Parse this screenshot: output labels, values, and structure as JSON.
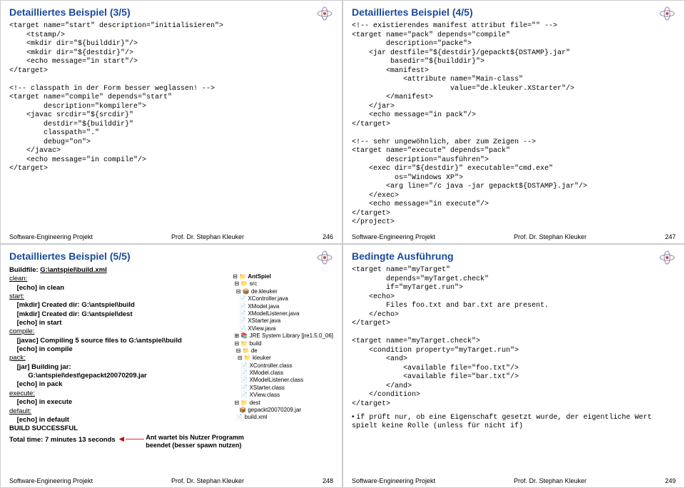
{
  "slides": {
    "s1": {
      "title": "Detailliertes Beispiel (3/5)",
      "code": "<target name=\"start\" description=\"initialisieren\">\n    <tstamp/>\n    <mkdir dir=\"${builddir}\"/>\n    <mkdir dir=\"${destdir}\"/>\n    <echo message=\"in start\"/>\n</target>\n\n<!-- classpath in der Form besser weglassen! -->\n<target name=\"compile\" depends=\"start\"\n        description=\"kompilere\">\n    <javac srcdir=\"${srcdir}\"\n        destdir=\"${builddir}\"\n        classpath=\".\"\n        debug=\"on\">\n    </javac>\n    <echo message=\"in compile\"/>\n</target>",
      "page": "246"
    },
    "s2": {
      "title": "Detailliertes Beispiel (4/5)",
      "code": "<!-- existierendes manifest attribut file=\"\" -->\n<target name=\"pack\" depends=\"compile\"\n        description=\"packe\">\n    <jar destfile=\"${destdir}/gepackt${DSTAMP}.jar\"\n         basedir=\"${builddir}\">\n        <manifest>\n            <attribute name=\"Main-class\"\n                       value=\"de.kleuker.XStarter\"/>\n        </manifest>\n    </jar>\n    <echo message=\"in pack\"/>\n</target>\n\n<!-- sehr ungewöhnlich, aber zum Zeigen -->\n<target name=\"execute\" depends=\"pack\"\n        description=\"ausführen\">\n    <exec dir=\"${destdir}\" executable=\"cmd.exe\"\n          os=\"Windows XP\">\n        <arg line=\"/c java -jar gepackt${DSTAMP}.jar\"/>\n    </exec>\n    <echo message=\"in execute\"/>\n</target>\n</project>",
      "page": "247"
    },
    "s3": {
      "title": "Detailliertes Beispiel (5/5)",
      "buildfile_label": "Buildfile: ",
      "buildfile": "G:\\antspiel\\build.xml",
      "log_clean": "clean:",
      "log_clean_echo": "[echo] in clean",
      "log_start": "start:",
      "log_start_mkdir1": "[mkdir] Created dir: G:\\antspiel\\build",
      "log_start_mkdir2": "[mkdir] Created dir: G:\\antspiel\\dest",
      "log_start_echo": "[echo] in start",
      "log_compile": "compile:",
      "log_compile_javac": "[javac] Compiling 5 source files to G:\\antspiel\\build",
      "log_compile_echo": "[echo] in compile",
      "log_pack": "pack:",
      "log_pack_jar": "[jar] Building jar:",
      "log_pack_jarfile": "G:\\antspiel\\dest\\gepackt20070209.jar",
      "log_pack_echo": "[echo] in pack",
      "log_execute": "execute:",
      "log_execute_echo": "[echo] in execute",
      "log_default": "default:",
      "log_default_echo": "[echo] in default",
      "log_success": "BUILD SUCCESSFUL",
      "log_time": "Total time: 7 minutes 13 seconds",
      "annotation": "Ant wartet bis Nutzer Programm beendet (besser spawn nutzen)",
      "tree_root": "AntSpiel",
      "tree_src": "src",
      "tree_pkg": "de.kleuker",
      "tree_files": [
        "XController.java",
        "XModel.java",
        "XModelListener.java",
        "XStarter.java",
        "XView.java"
      ],
      "tree_jre": "JRE System Library [jre1.5.0_06]",
      "tree_build": "build",
      "tree_de": "de",
      "tree_kleuker": "kleuker",
      "tree_classes": [
        "XController.class",
        "XModel.class",
        "XModelListener.class",
        "XStarter.class",
        "XView.class"
      ],
      "tree_dest": "dest",
      "tree_jar": "gepackt20070209.jar",
      "tree_buildxml": "build.xml",
      "page": "248"
    },
    "s4": {
      "title": "Bedingte Ausführung",
      "code1": "<target name=\"myTarget\"\n        depends=\"myTarget.check\"\n        if=\"myTarget.run\">\n    <echo>\n        Files foo.txt and bar.txt are present.\n    </echo>\n</target>\n\n<target name=\"myTarget.check\">\n    <condition property=\"myTarget.run\">\n        <and>\n            <available file=\"foo.txt\"/>\n            <available file=\"bar.txt\"/>\n        </and>\n    </condition>\n</target>",
      "bullet": "if prüft nur, ob eine Eigenschaft gesetzt wurde, der eigentliche Wert spielt keine Rolle (unless für nicht if)",
      "page": "249"
    },
    "footer": {
      "left": "Software-Engineering Projekt",
      "center": "Prof. Dr. Stephan Kleuker"
    }
  }
}
